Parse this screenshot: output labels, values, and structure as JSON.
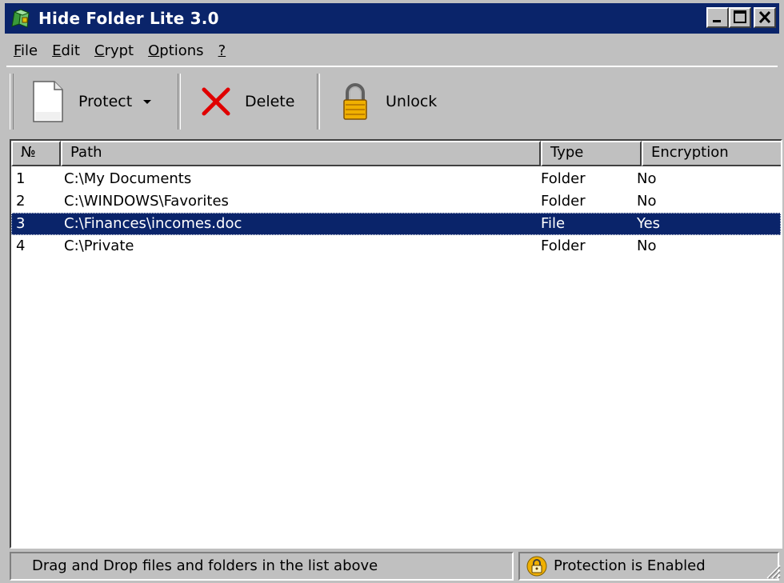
{
  "window": {
    "title": "Hide Folder Lite 3.0",
    "colors": {
      "title_bar": "#0a246a",
      "selection": "#0a246a",
      "face": "#c0c0c0",
      "lock": "#f0b000"
    }
  },
  "menu": [
    {
      "prefix": "",
      "accel": "F",
      "rest": "ile"
    },
    {
      "prefix": "",
      "accel": "E",
      "rest": "dit"
    },
    {
      "prefix": "",
      "accel": "C",
      "rest": "rypt"
    },
    {
      "prefix": "",
      "accel": "O",
      "rest": "ptions"
    },
    {
      "prefix": "",
      "accel": "?",
      "rest": ""
    }
  ],
  "toolbar": {
    "protect_label": "Protect",
    "delete_label": "Delete",
    "unlock_label": "Unlock",
    "icons": {
      "protect": "document-icon",
      "protect_dropdown": "dropdown-arrow-icon",
      "delete": "red-x-icon",
      "unlock": "padlock-icon"
    }
  },
  "list": {
    "columns": [
      "№",
      "Path",
      "Type",
      "Encryption"
    ],
    "rows": [
      {
        "num": "1",
        "path": "C:\\My Documents",
        "type": "Folder",
        "encryption": "No"
      },
      {
        "num": "2",
        "path": "C:\\WINDOWS\\Favorites",
        "type": "Folder",
        "encryption": "No"
      },
      {
        "num": "3",
        "path": "C:\\Finances\\incomes.doc",
        "type": "File",
        "encryption": "Yes"
      },
      {
        "num": "4",
        "path": "C:\\Private",
        "type": "Folder",
        "encryption": "No"
      }
    ],
    "selected_row": 3
  },
  "status": {
    "hint": "Drag and Drop files and folders in the list above",
    "protection": "Protection is Enabled"
  }
}
